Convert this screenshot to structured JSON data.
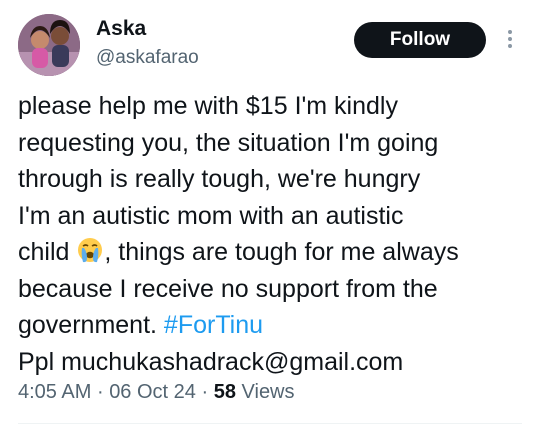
{
  "author": {
    "display_name": "Aska",
    "handle": "@askafarao",
    "avatar": "profile-photo"
  },
  "follow_label": "Follow",
  "more_icon": "more-options-icon",
  "tweet": {
    "lines": [
      {
        "text": "please help me with $15 I'm kindly"
      },
      {
        "text": "requesting you, the situation I'm going"
      },
      {
        "text": "through is really tough, we're hungry"
      },
      {
        "text": "I'm an autistic mom with an autistic"
      },
      {
        "before_emoji": "child ",
        "emoji": "loudly-crying-face",
        "after_emoji": ", things are tough for me always"
      },
      {
        "text": "because I receive no support from the"
      },
      {
        "before_hashtag": "government. ",
        "hashtag": "#ForTinu"
      },
      {
        "text": "Ppl muchukashadrack@gmail.com"
      }
    ]
  },
  "meta": {
    "time": "4:05 AM",
    "separator": "·",
    "date": "06 Oct 24",
    "views_count": "58",
    "views_label": "Views"
  },
  "colors": {
    "link": "#1d9bf0",
    "secondary_text": "#536471",
    "primary_text": "#0f1419",
    "button_bg": "#0f1419"
  }
}
